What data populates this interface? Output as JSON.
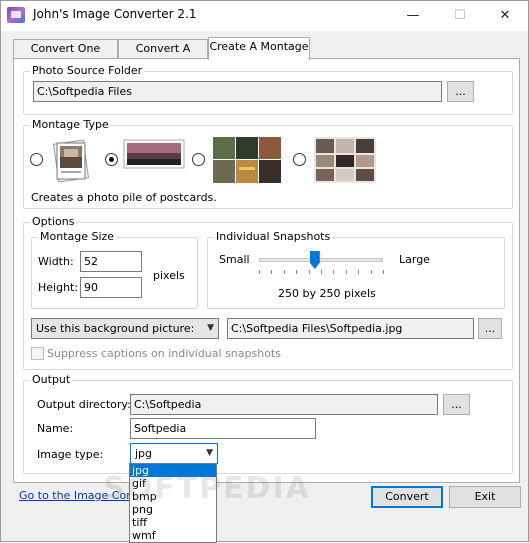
{
  "window": {
    "title": "John's Image Converter 2.1",
    "minimize": "—",
    "maximize": "☐",
    "close": "✕"
  },
  "tabs": [
    {
      "label": "Convert One Image"
    },
    {
      "label": "Convert A Folder"
    },
    {
      "label": "Create A Montage"
    }
  ],
  "source": {
    "group_label": "Photo Source Folder",
    "path": "C:\\Softpedia Files",
    "browse_label": "..."
  },
  "montage_type": {
    "group_label": "Montage Type",
    "options": [
      "photo-pile-single",
      "photo-pile-postcards",
      "grid-tiles",
      "collage-grid"
    ],
    "selected": "photo-pile-postcards",
    "description": "Creates a photo pile of postcards."
  },
  "options": {
    "group_label": "Options",
    "montage_size": {
      "label": "Montage Size",
      "width_label": "Width:",
      "width_value": "52",
      "height_label": "Height:",
      "height_value": "90",
      "units": "pixels"
    },
    "snapshots": {
      "label": "Individual Snapshots",
      "min_label": "Small",
      "max_label": "Large",
      "value_text": "250 by 250 pixels",
      "level": 0.45
    },
    "background": {
      "select_value": "Use this background picture:",
      "path": "C:\\Softpedia Files\\Softpedia.jpg",
      "browse_label": "..."
    },
    "suppress_captions": {
      "label": "Suppress captions on individual snapshots",
      "checked": false
    }
  },
  "output": {
    "group_label": "Output",
    "directory_label": "Output directory:",
    "directory_value": "C:\\Softpedia",
    "browse_label": "...",
    "name_label": "Name:",
    "name_value": "Softpedia",
    "type_label": "Image type:",
    "type_value": "jpg",
    "type_options": [
      "jpg",
      "gif",
      "bmp",
      "png",
      "tiff",
      "wmf"
    ]
  },
  "footer": {
    "link": "Go to the Image Converter",
    "convert_label": "Convert",
    "exit_label": "Exit"
  },
  "watermark": "SOFTPEDIA",
  "colors": {
    "accent": "#0078d7",
    "link": "#0033cc"
  }
}
